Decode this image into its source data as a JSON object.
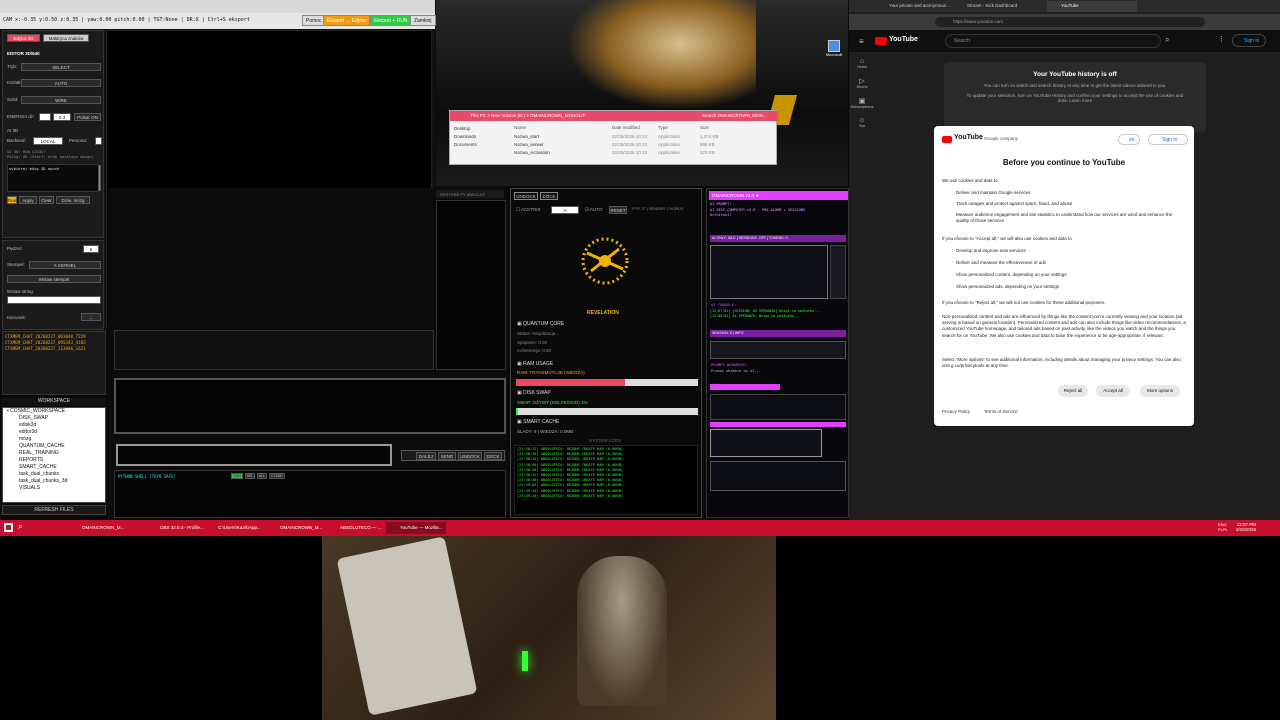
{
  "editor": {
    "titlebar": "CAM x:-0.35 y:0.50 z:0.35 | yaw:0.00 pitch:0.00 | TGT:None | DR:X | Ctrl+S eksport",
    "buttons": [
      "Pomoc",
      "Eksport → Edytor",
      "Eksport + RUN",
      "Zamknij"
    ],
    "top_buttons": [
      "Edytor 3D",
      "Maktryca znaków"
    ],
    "section_title": "EDITOR 3D/640",
    "rows": [
      {
        "label": "Tryb:",
        "value": "SELECT"
      },
      {
        "label": "Kształt:",
        "value": "AUTO"
      },
      {
        "label": "Solid:",
        "value": "WIRE"
      }
    ],
    "energia_label": "ENERGIA dz:",
    "energia_value": "0.3",
    "pulsar_btn": "Pulsar ON",
    "ai_section": "AI 3D",
    "backend_label": "Backend:",
    "backend_value": "LOCAL",
    "persona_label": "Persona:",
    "ai_text": "AI 3D: RUN LOCAL!\nPolig: OK (Start: brak katalogu mózgu)",
    "ai_text2": "wybieraj mózg 3D epoch",
    "action_buttons": [
      "Run",
      "Apply",
      "Clear",
      "Dziw. mózg"
    ],
    "pedzel_label": "Pędzel:",
    "pedzel_value": "6",
    "stempel_label": "Stempel:",
    "stempel_value": "X KERNEL",
    "wstaw_btn": "Wstaw stempel",
    "string_label": "Wstaw string:",
    "kierunek_label": "Kierunek:",
    "kierunek_value": "→"
  },
  "chat_files": [
    "CTXMEM_CHAT_20260227_063048_7229",
    "CTXMEM_CHAT_20260227_095343_4183",
    "CTXMEM_CHAT_20260227_213946_1621"
  ],
  "workspace": {
    "title": "WORKSPACE",
    "root": "COSMIC_WORKSPACE",
    "items": [
      "DISK_SWAP",
      "edisk3d",
      "editor3d",
      "mózg",
      "QUANTUM_CACHE",
      "REAL_TRAINING",
      "REPORTS",
      "SMART_CACHE",
      "task_dual_chunks",
      "task_dual_chunks_3d",
      "VISUALS"
    ],
    "refresh": "REFRESH FILES"
  },
  "explorer": {
    "path": "This PC > New Volume (E:) > OMAINCROWN_MONOLIT",
    "search": "Search OMAINCROWN_MON...",
    "sidebar": [
      "Desktop",
      "Downloads",
      "Documents"
    ],
    "columns": [
      "Name",
      "Date modified",
      "Type",
      "Size"
    ],
    "files": [
      {
        "name": "Nazwa_start",
        "date": "02/25/2026 10:13",
        "type": "Application",
        "size": "1,274 KB"
      },
      {
        "name": "Nazwa_serwer",
        "date": "02/25/2026 10:13",
        "type": "Application",
        "size": "865 KB"
      },
      {
        "name": "Nazwa_Activation",
        "date": "02/25/2026 10:13",
        "type": "Application",
        "size": "523 KB"
      }
    ],
    "desktop_icon": "Microsoft"
  },
  "mid": {
    "restore_label": "RESTORE PY ABSOLUT",
    "python_shell": "PYTHON SHELL [TRYB SAFE]",
    "shell_btns": [
      "RUN",
      "SEL",
      "ALL",
      "CLEAR"
    ],
    "bottom_btns": [
      "DALEJ",
      "SEND",
      "UNDOCK",
      "DOCK"
    ]
  },
  "quantum": {
    "top_btns": [
      "UNDOCK",
      "DOCK"
    ],
    "acktrix": "ACKTRIX",
    "auto": "AUTO",
    "reset": "RESET",
    "fps": "FPS: 27 | RENDER: CHORUS",
    "revelation": "REVELATION",
    "core_title": "QUANTUM CORE",
    "core_lines": [
      "Status: Inicjalizacja...",
      "Splątanie: 0.00",
      "Koherencja: 0.00"
    ],
    "ram_title": "RAM USAGE",
    "ram_line": "RAM: TRANSMUTUJE (WIEDZA)",
    "ram_fill": 0.6,
    "swap_title": "DISK SWAP",
    "swap_line": "SWAP: OŻYWY (SOLFEGGIO) 1%",
    "swap_fill": 0.01,
    "cache_title": "SMART CACHE",
    "cache_line": "ŚLADY: 6 | WIEDZA: 0.0MB",
    "logs_title": "SYSTEM LOGS",
    "logs": [
      "[21:38:22] ABSOLUTECO: REZONS CREATE RAM (0.00GB)",
      "[21:38:28] ABSOLUTECO: REZONS CREATE RAM (0.00GB)",
      "[21:38:34] ABSOLUTECO: REZONS CREATE RAM (0.00GB)",
      "[21:38:40] ABSOLUTECO: REZONS CREATE RAM (0.00GB)",
      "[21:38:46] ABSOLUTECO: REZONS CREATE RAM (0.00GB)",
      "[21:38:52] ABSOLUTECO: REZONS CREATE RAM (0.00GB)",
      "[21:38:58] ABSOLUTECO: REZONS CREATE RAM (0.00GB)",
      "[21:39:04] ABSOLUTECO: REZONS CREATE RAM (0.00GB)",
      "[21:39:10] ABSOLUTECO: REZONS CREATE RAM (0.00GB)",
      "[21:39:16] ABSOLUTECO: REZONS CREATE RAM (0.00GB)"
    ]
  },
  "pink": {
    "title": "OMAINCROWN v3.0 ★",
    "line1": "AI PROMPT:",
    "line2": "AI SELF-COMPUTER v3.0 - PRO AIORB + SESSIONS",
    "line3": "Architekt!",
    "line4": "AI ONLY: IDLE | SESSIONY: OFF | TOKENS: 0",
    "console": "AI CONSOLE:",
    "console_lines": [
      "[12:07:02] [SESSION: AS SPERANZA] Wciąż na nasłuchu...",
      "[12:08:02] AS SPERANZA: Wciąż na nasłuchu..."
    ],
    "section2": "SESSION: 0 | INFO",
    "prompt": "PROMPT WOBARBIE:",
    "prompt_text": "Prompt wbabbie do AI..."
  },
  "youtube": {
    "tabs": [
      "Your private and anonymous...",
      "Stream - Kick Dashboard",
      "YouTube"
    ],
    "url": "https://www.youtube.com",
    "logo": "YouTube",
    "search": "Search",
    "signin": "Sign in",
    "side": [
      "Home",
      "Shorts",
      "Subscriptions",
      "You"
    ],
    "history_title": "Your YouTube history is off",
    "history_text": "You can turn on watch and search history at any time to get the latest videos tailored to you.",
    "history_text2": "To update your selection, turn on YouTube History and confirm your settings to accept the use of cookies and data. Learn more",
    "dialog": {
      "brand": "YouTube",
      "company": "A Google company",
      "lang": "en",
      "signin": "Sign in",
      "title": "Before you continue to YouTube",
      "we_use": "We use cookies and data to",
      "list1": [
        "Deliver and maintain Google services",
        "Track outages and protect against spam, fraud, and abuse",
        "Measure audience engagement and site statistics to understand how our services are used and enhance the quality of those services"
      ],
      "accept_intro": "If you choose to \"Accept all,\" we will also use cookies and data to",
      "list2": [
        "Develop and improve new services",
        "Deliver and measure the effectiveness of ads",
        "Show personalized content, depending on your settings",
        "Show personalized ads, depending on your settings"
      ],
      "reject_intro": "If you choose to \"Reject all,\" we will not use cookies for these additional purposes.",
      "nonpers": "Non-personalized content and ads are influenced by things like the content you're currently viewing and your location (ad serving is based on general location). Personalized content and ads can also include things like video recommendations, a customized YouTube homepage, and tailored ads based on past activity, like the videos you watch and the things you search for on YouTube. We also use cookies and data to tailor the experience to be age-appropriate, if relevant.",
      "more_info": "Select \"More options\" to see additional information, including details about managing your privacy settings. You can also visit g.co/privacytools at any time.",
      "reject": "Reject all",
      "accept": "Accept all",
      "more": "More options",
      "privacy": "Privacy Policy",
      "terms": "Terms of Service"
    }
  },
  "taskbar": {
    "apps": [
      "OMAINCROWN_M...",
      "OBS 32.0.4 - Profile...",
      "C:\\Users\\Kazik\\App...",
      "OMAINCROWN_M...",
      "ABSOLUTECO — ...",
      "YouTube — Mozilla..."
    ],
    "lang": "ENG PLPL",
    "time": "12:07 PM",
    "date": "2/28/2026"
  },
  "colors": {
    "taskbar": "#c8102e",
    "yt_red": "#ff0000",
    "cyan": "#22eeee",
    "magenta": "#e040fb",
    "gold": "#f0b400"
  }
}
